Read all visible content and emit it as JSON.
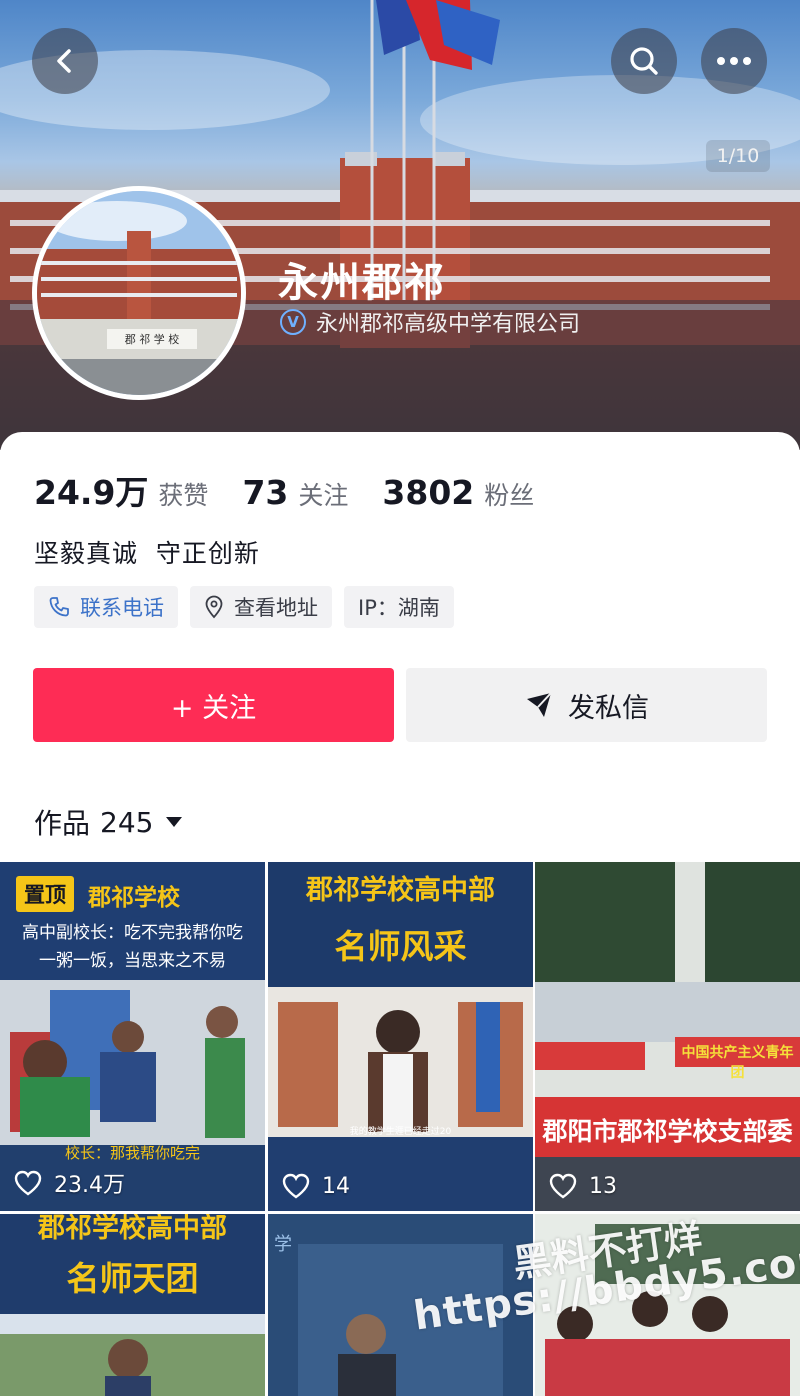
{
  "header": {
    "back_icon": "chevron-left-icon",
    "search_icon": "search-icon",
    "more_icon": "more-dots-icon",
    "page_counter": "1/10"
  },
  "profile": {
    "name": "永州郡祁",
    "verified_label": "永州郡祁高级中学有限公司",
    "bio": "坚毅真诚  守正创新",
    "stats": [
      {
        "value": "24.9万",
        "label": "获赞"
      },
      {
        "value": "73",
        "label": "关注"
      },
      {
        "value": "3802",
        "label": "粉丝"
      }
    ],
    "chips": {
      "phone": "联系电话",
      "address": "查看地址",
      "ip": "IP：湖南"
    }
  },
  "actions": {
    "follow": "+ 关注",
    "message": "发私信"
  },
  "works": {
    "label": "作品",
    "count": "245"
  },
  "tiles": [
    {
      "pin": "置顶",
      "school": "郡祁学校",
      "line1": "高中副校长：吃不完我帮你吃",
      "line2": "一粥一饭，当思来之不易",
      "caption": "校长：那我帮你吃完",
      "likes": "23.4万"
    },
    {
      "title1": "郡祁学校高中部",
      "title2": "名师风采",
      "sign": "郡祁学校高中部",
      "subtitle": "我的教学生涯已经走过20",
      "likes": "14"
    },
    {
      "banner": "郡阳市郡祁学校支部委",
      "banner2": "中国共产主义青年团",
      "likes": "13"
    },
    {
      "title1": "郡祁学校高中部",
      "title2": "名师天团"
    },
    {
      "corner": "学"
    },
    {}
  ],
  "watermark": {
    "line1": "黑料不打烊",
    "line2": "https://bbdy5.com"
  },
  "colors": {
    "accent": "#fe2c55",
    "link": "#3d73c9"
  }
}
